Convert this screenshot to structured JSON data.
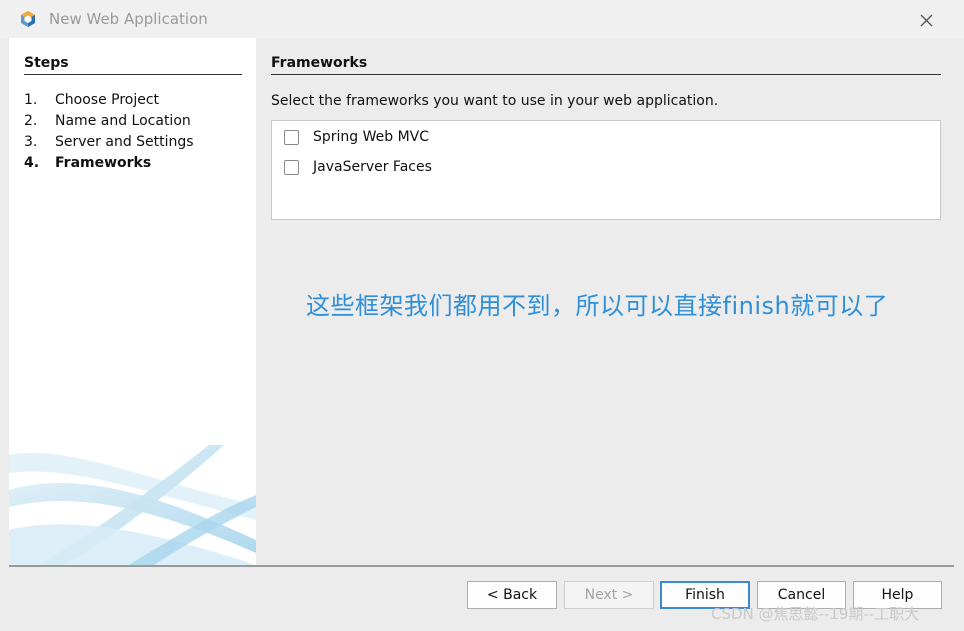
{
  "window": {
    "title": "New Web Application",
    "icon": "netbeans-cube-icon",
    "close_icon": "close-icon"
  },
  "steps": {
    "title": "Steps",
    "items": [
      {
        "num": "1.",
        "label": "Choose Project",
        "current": false
      },
      {
        "num": "2.",
        "label": "Name and Location",
        "current": false
      },
      {
        "num": "3.",
        "label": "Server and Settings",
        "current": false
      },
      {
        "num": "4.",
        "label": "Frameworks",
        "current": true
      }
    ]
  },
  "content": {
    "title": "Frameworks",
    "prompt": "Select the frameworks you want to use in your web application.",
    "frameworks": [
      {
        "label": "Spring Web MVC",
        "checked": false
      },
      {
        "label": "JavaServer Faces",
        "checked": false
      }
    ],
    "annotation": "这些框架我们都用不到，所以可以直接finish就可以了"
  },
  "buttons": {
    "back": "< Back",
    "next": "Next >",
    "finish": "Finish",
    "cancel": "Cancel",
    "help": "Help"
  },
  "watermark": "CSDN @焦思懿--19期--工职大",
  "colors": {
    "accent": "#3c8ad6",
    "annotation": "#2f8fd8"
  }
}
